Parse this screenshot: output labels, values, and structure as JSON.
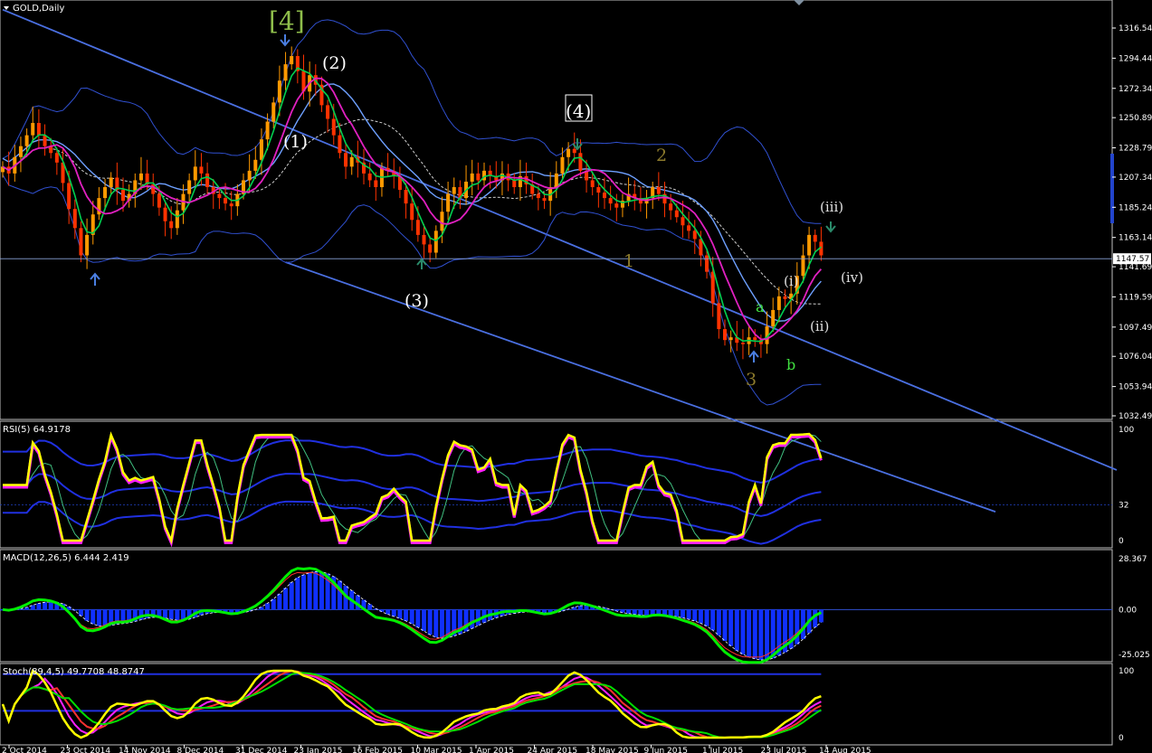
{
  "window": {
    "title": "GOLD,Daily"
  },
  "colors": {
    "background": "#000000",
    "up_candle": "#ff9900",
    "down_candle": "#ff3300",
    "channel": "#4a6fe0",
    "bollinger": "#3050d0",
    "ma_fast": "#00d050",
    "ma_slow": "#e020c0",
    "rsi_line": "#ffff00",
    "macd_line": "#00ee00",
    "macd_hist": "#1030ff",
    "stoch_line": "#ffff00",
    "price_line": "#8aa2d8",
    "scroll_marker": "#2244cc"
  },
  "price_axis": {
    "ticks": [
      "1316.54",
      "1294.44",
      "1272.34",
      "1250.89",
      "1228.79",
      "1207.34",
      "1185.24",
      "1163.14",
      "1141.69",
      "1119.59",
      "1097.49",
      "1076.04",
      "1053.94",
      "1032.49"
    ],
    "current_price": "1147.57"
  },
  "date_axis": {
    "ticks": [
      "2 Oct 2014",
      "23 Oct 2014",
      "14 Nov 2014",
      "8 Dec 2014",
      "31 Dec 2014",
      "23 Jan 2015",
      "16 Feb 2015",
      "10 Mar 2015",
      "1 Apr 2015",
      "24 Apr 2015",
      "18 May 2015",
      "9 Jun 2015",
      "1 Jul 2015",
      "23 Jul 2015",
      "14 Aug 2015"
    ]
  },
  "wave_labels": {
    "w4_major": "[4]",
    "w2_minor": "(2)",
    "w1_minor": "(1)",
    "w3_minor": "(3)",
    "w4_minor": "(4)",
    "w2_gold": "2",
    "w1_gold": "1",
    "w3_gold": "3",
    "wa": "a",
    "wb": "b",
    "wi": "(i)",
    "wii": "(ii)",
    "wiii": "(iii)",
    "wiv": "(iv)"
  },
  "panels": {
    "rsi": {
      "title": "RSI(5) 64.9178",
      "levels": [
        "100",
        "32",
        "0"
      ]
    },
    "macd": {
      "title": "MACD(12,26,5) 6.444 2.419",
      "levels": [
        "28.367",
        "0.00",
        "-25.025"
      ]
    },
    "stoch": {
      "title": "Stoch(89,4,5) 49.7708 48.8747",
      "levels": [
        "100",
        "0"
      ]
    }
  },
  "chart_data": {
    "type": "candlestick",
    "symbol": "GOLD",
    "timeframe": "Daily",
    "ylim": [
      1032.49,
      1316.54
    ],
    "current_price": 1147.57,
    "closes": [
      1215,
      1210,
      1222,
      1230,
      1238,
      1247,
      1238,
      1230,
      1225,
      1218,
      1203,
      1184,
      1170,
      1150,
      1165,
      1180,
      1192,
      1200,
      1207,
      1198,
      1190,
      1195,
      1205,
      1210,
      1202,
      1195,
      1185,
      1175,
      1170,
      1183,
      1195,
      1205,
      1215,
      1210,
      1200,
      1195,
      1192,
      1188,
      1186,
      1195,
      1205,
      1212,
      1220,
      1235,
      1248,
      1262,
      1278,
      1290,
      1296,
      1285,
      1270,
      1282,
      1275,
      1260,
      1250,
      1238,
      1225,
      1215,
      1222,
      1218,
      1210,
      1205,
      1200,
      1214,
      1212,
      1208,
      1198,
      1188,
      1176,
      1165,
      1158,
      1152,
      1168,
      1182,
      1195,
      1200,
      1192,
      1204,
      1210,
      1205,
      1212,
      1208,
      1205,
      1210,
      1205,
      1200,
      1208,
      1202,
      1195,
      1192,
      1190,
      1200,
      1210,
      1222,
      1228,
      1225,
      1212,
      1205,
      1200,
      1196,
      1192,
      1188,
      1185,
      1190,
      1195,
      1192,
      1188,
      1192,
      1200,
      1195,
      1188,
      1183,
      1178,
      1172,
      1168,
      1162,
      1150,
      1138,
      1115,
      1096,
      1088,
      1090,
      1086,
      1085,
      1090,
      1088,
      1085,
      1098,
      1110,
      1120,
      1118,
      1122,
      1135,
      1150,
      1165,
      1160,
      1150
    ]
  },
  "chart_channel": {
    "upper_line": [
      [
        0,
        1330
      ],
      [
        140,
        1075
      ]
    ],
    "lower_line": [
      [
        47,
        1145
      ],
      [
        118,
        1035
      ]
    ]
  }
}
